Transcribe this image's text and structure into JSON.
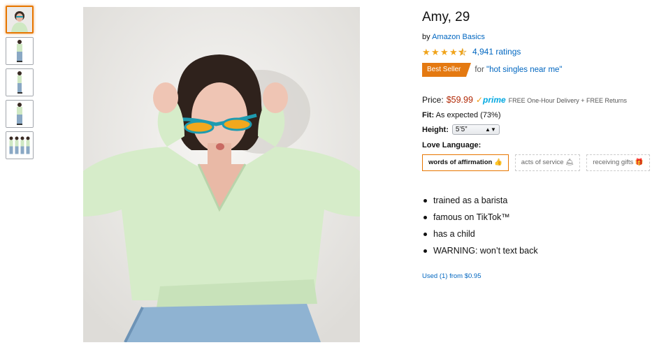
{
  "thumbnails": [
    {
      "name": "thumb-closeup"
    },
    {
      "name": "thumb-standing-front"
    },
    {
      "name": "thumb-standing-side"
    },
    {
      "name": "thumb-standing-back"
    },
    {
      "name": "thumb-group"
    }
  ],
  "product": {
    "title": "Amy, 29",
    "by_prefix": "by",
    "brand": "Amazon Basics",
    "rating_stars": 4.5,
    "rating_count": "4,941 ratings",
    "badge": "Best Seller",
    "badge_for_prefix": "for",
    "badge_for_link": "\"hot singles near me\"",
    "price_label": "Price:",
    "price": "$59.99",
    "prime_label": "prime",
    "delivery": "FREE One-Hour Delivery + FREE Returns",
    "fit_label": "Fit:",
    "fit_value": "As expected (73%)",
    "height_label": "Height:",
    "height_value": "5’5”",
    "love_language_label": "Love Language:",
    "love_language_options": [
      {
        "label": "words of affirmation 👍",
        "selected": true
      },
      {
        "label": "acts of service 🛎",
        "selected": false
      },
      {
        "label": "receiving gifts 🎁",
        "selected": false
      }
    ],
    "bullets": [
      "trained as a barista",
      "famous on TikTok™",
      "has a child",
      "WARNING: won’t text back"
    ],
    "used_offer": "Used (1) from $0.95"
  },
  "colors": {
    "accent_orange": "#e47911",
    "link_blue": "#0066c0",
    "price_red": "#b12704",
    "star_gold": "#f0a41b"
  }
}
